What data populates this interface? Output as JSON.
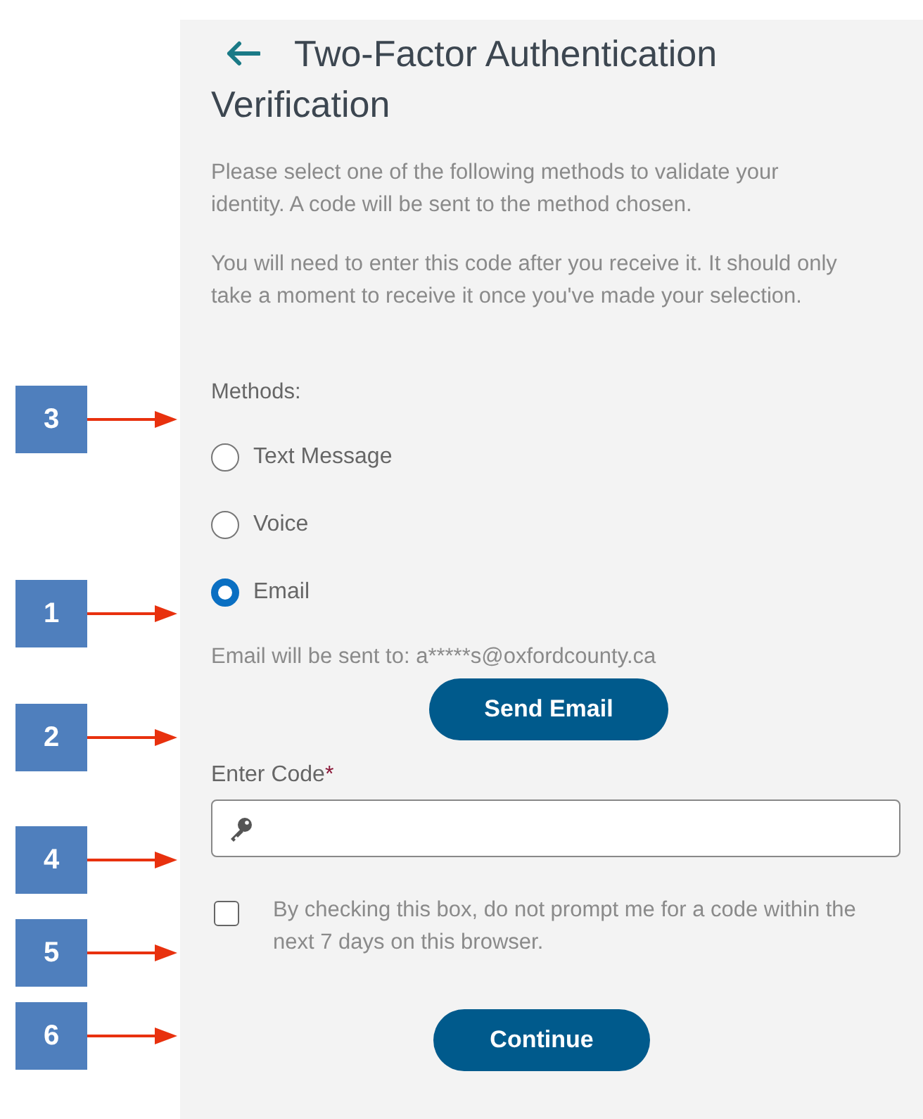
{
  "callouts": [
    {
      "label": "3"
    },
    {
      "label": "1"
    },
    {
      "label": "2"
    },
    {
      "label": "4"
    },
    {
      "label": "5"
    },
    {
      "label": "6"
    }
  ],
  "title_lines": [
    "Two-Factor Authentication",
    "Verification"
  ],
  "paragraphs": [
    "Please select one of the following methods to validate your identity. A code will be sent to the method chosen.",
    "You will need to enter this code after you receive it. It should only take a moment to receive it once you've made your selection."
  ],
  "methods": {
    "label": "Methods:",
    "options": [
      {
        "label": "Text Message",
        "selected": false
      },
      {
        "label": "Voice",
        "selected": false
      },
      {
        "label": "Email",
        "selected": true
      }
    ]
  },
  "email_note": "Email will be sent to: a*****s@oxfordcounty.ca",
  "send_button": "Send Email",
  "code_field": {
    "label": "Enter Code",
    "required_mark": "*"
  },
  "remember": {
    "label": "By checking this box, do not prompt me for a code within the next 7 days on this browser.",
    "checked": false
  },
  "continue_button": "Continue"
}
